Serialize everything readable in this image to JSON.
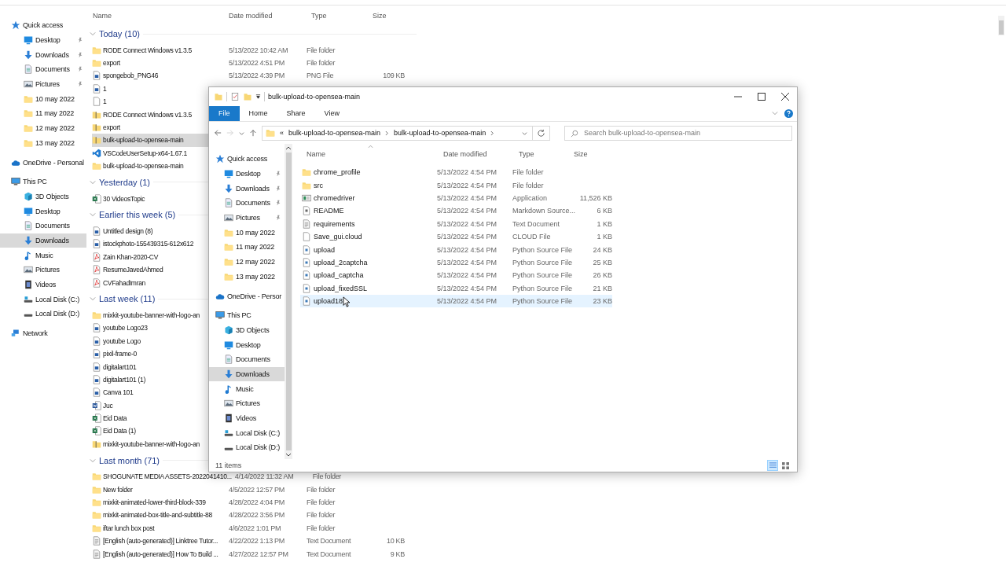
{
  "background_window": {
    "nav": [
      {
        "label": "Quick access",
        "kind": "star",
        "selected": false,
        "children": [
          {
            "label": "Desktop",
            "kind": "desktop",
            "pinned": true,
            "selected": false
          },
          {
            "label": "Downloads",
            "kind": "download",
            "pinned": true,
            "selected": false
          },
          {
            "label": "Documents",
            "kind": "documents",
            "pinned": true,
            "selected": false
          },
          {
            "label": "Pictures",
            "kind": "pictures",
            "pinned": true,
            "selected": false
          },
          {
            "label": "10 may 2022",
            "kind": "folder",
            "pinned": false,
            "selected": false
          },
          {
            "label": "11 may 2022",
            "kind": "folder",
            "pinned": false,
            "selected": false
          },
          {
            "label": "12 may 2022",
            "kind": "folder",
            "pinned": false,
            "selected": false
          },
          {
            "label": "13 may 2022",
            "kind": "folder",
            "pinned": false,
            "selected": false
          }
        ]
      },
      {
        "label": "OneDrive - Personal",
        "kind": "cloud",
        "selected": false
      },
      {
        "label": "This PC",
        "kind": "pc",
        "selected": false,
        "children": [
          {
            "label": "3D Objects",
            "kind": "cube",
            "selected": false
          },
          {
            "label": "Desktop",
            "kind": "desktop",
            "selected": false
          },
          {
            "label": "Documents",
            "kind": "documents",
            "selected": false
          },
          {
            "label": "Downloads",
            "kind": "download",
            "selected": true
          },
          {
            "label": "Music",
            "kind": "music",
            "selected": false
          },
          {
            "label": "Pictures",
            "kind": "pictures",
            "selected": false
          },
          {
            "label": "Videos",
            "kind": "videos",
            "selected": false
          },
          {
            "label": "Local Disk (C:)",
            "kind": "system-disk",
            "selected": false
          },
          {
            "label": "Local Disk (D:)",
            "kind": "disk",
            "selected": false
          }
        ]
      },
      {
        "label": "Network",
        "kind": "network",
        "selected": false
      }
    ],
    "columns": [
      "Name",
      "Date modified",
      "Type",
      "Size"
    ],
    "groups": [
      {
        "title": "Today (10)",
        "expanded": true,
        "rows": [
          {
            "name": "RODE Connect Windows v1.3.5",
            "kind": "folder",
            "date": "5/13/2022 10:42 AM",
            "type": "File folder",
            "selected": false
          },
          {
            "name": "export",
            "kind": "folder",
            "date": "5/13/2022 4:51 PM",
            "type": "File folder",
            "selected": false
          },
          {
            "name": "spongebob_PNG46",
            "kind": "image",
            "date": "5/13/2022 4:39 PM",
            "type": "PNG File",
            "size": "109 KB",
            "selected": false
          },
          {
            "name": "1",
            "kind": "image",
            "selected": false
          },
          {
            "name": "1",
            "kind": "file",
            "selected": false
          },
          {
            "name": "RODE Connect Windows v1.3.5",
            "kind": "zip",
            "selected": false
          },
          {
            "name": "export",
            "kind": "zip",
            "selected": false
          },
          {
            "name": "bulk-upload-to-opensea-main",
            "kind": "zip",
            "selected": true
          },
          {
            "name": "VSCodeUserSetup-x64-1.67.1",
            "kind": "vscode",
            "selected": false
          },
          {
            "name": "bulk-upload-to-opensea-main",
            "kind": "folder",
            "selected": false
          }
        ]
      },
      {
        "title": "Yesterday (1)",
        "expanded": true,
        "rows": [
          {
            "name": "30 VideosTopic",
            "kind": "sheet",
            "selected": false
          }
        ]
      },
      {
        "title": "Earlier this week (5)",
        "expanded": true,
        "rows": [
          {
            "name": "Untitled design (8)",
            "kind": "image",
            "selected": false
          },
          {
            "name": "istockphoto-155439315-612x612",
            "kind": "image",
            "selected": false
          },
          {
            "name": "Zain Khan-2020-CV",
            "kind": "pdf",
            "selected": false
          },
          {
            "name": "ResumeJavedAhmed",
            "kind": "pdf",
            "selected": false
          },
          {
            "name": "CVFahadImran",
            "kind": "pdf",
            "selected": false
          }
        ]
      },
      {
        "title": "Last week (11)",
        "expanded": true,
        "rows": [
          {
            "name": "mixkit-youtube-banner-with-logo-an",
            "kind": "folder",
            "selected": false
          },
          {
            "name": "youtube Logo23",
            "kind": "image",
            "selected": false
          },
          {
            "name": "youtube Logo",
            "kind": "image",
            "selected": false
          },
          {
            "name": "pixil-frame-0",
            "kind": "image",
            "selected": false
          },
          {
            "name": "digitalart101",
            "kind": "image",
            "selected": false
          },
          {
            "name": "digitalart101 (1)",
            "kind": "image",
            "selected": false
          },
          {
            "name": "Canva 101",
            "kind": "image",
            "selected": false
          },
          {
            "name": "Juc",
            "kind": "doc",
            "selected": false
          },
          {
            "name": "Eid Data",
            "kind": "sheet",
            "selected": false
          },
          {
            "name": "Eid Data (1)",
            "kind": "sheet",
            "selected": false
          },
          {
            "name": "mixkit-youtube-banner-with-logo-an",
            "kind": "zip",
            "selected": false
          }
        ]
      },
      {
        "title": "Last month (71)",
        "expanded": true,
        "rows": [
          {
            "name": "SHOGUNATE MEDIA ASSETS-2022041410...",
            "kind": "folder",
            "date": "4/14/2022 11:32 AM",
            "type": "File folder",
            "selected": false
          },
          {
            "name": "New folder",
            "kind": "folder",
            "date": "4/5/2022 12:57 PM",
            "type": "File folder",
            "selected": false
          },
          {
            "name": "mixkit-animated-lower-third-block-339",
            "kind": "folder",
            "date": "4/28/2022 4:04 PM",
            "type": "File folder",
            "selected": false
          },
          {
            "name": "mixkit-animated-box-title-and-subtitle-88",
            "kind": "folder",
            "date": "4/28/2022 3:56 PM",
            "type": "File folder",
            "selected": false
          },
          {
            "name": "iftar lunch box post",
            "kind": "folder",
            "date": "4/6/2022 1:01 PM",
            "type": "File folder",
            "selected": false
          },
          {
            "name": "[English (auto-generated)] Linktree Tutor...",
            "kind": "text",
            "date": "4/22/2022 1:13 PM",
            "type": "Text Document",
            "size": "10 KB",
            "selected": false
          },
          {
            "name": "[English (auto-generated)] How To Build ...",
            "kind": "text",
            "date": "4/27/2022 12:57 PM",
            "type": "Text Document",
            "size": "9 KB",
            "selected": false
          }
        ]
      }
    ]
  },
  "window": {
    "title": "bulk-upload-to-opensea-main",
    "ribbon_tabs": [
      {
        "label": "File",
        "selected": true
      },
      {
        "label": "Home",
        "selected": false
      },
      {
        "label": "Share",
        "selected": false
      },
      {
        "label": "View",
        "selected": false
      }
    ],
    "address": {
      "overflow": "«",
      "path": [
        "bulk-upload-to-opensea-main",
        "bulk-upload-to-opensea-main"
      ]
    },
    "search": {
      "placeholder": "Search bulk-upload-to-opensea-main"
    },
    "nav": [
      {
        "label": "Quick access",
        "kind": "star",
        "selected": false,
        "children": [
          {
            "label": "Desktop",
            "kind": "desktop",
            "pinned": true,
            "selected": false
          },
          {
            "label": "Downloads",
            "kind": "download",
            "pinned": true,
            "selected": false
          },
          {
            "label": "Documents",
            "kind": "documents",
            "pinned": true,
            "selected": false
          },
          {
            "label": "Pictures",
            "kind": "pictures",
            "pinned": true,
            "selected": false
          },
          {
            "label": "10 may 2022",
            "kind": "folder",
            "pinned": false,
            "selected": false
          },
          {
            "label": "11 may 2022",
            "kind": "folder",
            "pinned": false,
            "selected": false
          },
          {
            "label": "12 may 2022",
            "kind": "folder",
            "pinned": false,
            "selected": false
          },
          {
            "label": "13 may 2022",
            "kind": "folder",
            "pinned": false,
            "selected": false
          }
        ]
      },
      {
        "label": "OneDrive - Persor",
        "kind": "cloud",
        "selected": false
      },
      {
        "label": "This PC",
        "kind": "pc",
        "selected": false,
        "children": [
          {
            "label": "3D Objects",
            "kind": "cube",
            "selected": false
          },
          {
            "label": "Desktop",
            "kind": "desktop",
            "selected": false
          },
          {
            "label": "Documents",
            "kind": "documents",
            "selected": false
          },
          {
            "label": "Downloads",
            "kind": "download",
            "selected": true
          },
          {
            "label": "Music",
            "kind": "music",
            "selected": false
          },
          {
            "label": "Pictures",
            "kind": "pictures",
            "selected": false
          },
          {
            "label": "Videos",
            "kind": "videos",
            "selected": false
          },
          {
            "label": "Local Disk (C:)",
            "kind": "system-disk",
            "selected": false
          },
          {
            "label": "Local Disk (D:)",
            "kind": "disk",
            "selected": false
          }
        ]
      }
    ],
    "columns": [
      "Name",
      "Date modified",
      "Type",
      "Size"
    ],
    "rows": [
      {
        "name": "chrome_profile",
        "kind": "folder",
        "date": "5/13/2022 4:54 PM",
        "type": "File folder",
        "selected": false
      },
      {
        "name": "src",
        "kind": "folder",
        "date": "5/13/2022 4:54 PM",
        "type": "File folder",
        "selected": false
      },
      {
        "name": "chromedriver",
        "kind": "app",
        "date": "5/13/2022 4:54 PM",
        "type": "Application",
        "size": "11,526 KB",
        "selected": false
      },
      {
        "name": "README",
        "kind": "markdown",
        "date": "5/13/2022 4:54 PM",
        "type": "Markdown Source...",
        "size": "6 KB",
        "selected": false
      },
      {
        "name": "requirements",
        "kind": "text",
        "date": "5/13/2022 4:54 PM",
        "type": "Text Document",
        "size": "1 KB",
        "selected": false
      },
      {
        "name": "Save_gui.cloud",
        "kind": "file",
        "date": "5/13/2022 4:54 PM",
        "type": "CLOUD File",
        "size": "1 KB",
        "selected": false
      },
      {
        "name": "upload",
        "kind": "python",
        "date": "5/13/2022 4:54 PM",
        "type": "Python Source File",
        "size": "24 KB",
        "selected": false
      },
      {
        "name": "upload_2captcha",
        "kind": "python",
        "date": "5/13/2022 4:54 PM",
        "type": "Python Source File",
        "size": "25 KB",
        "selected": false
      },
      {
        "name": "upload_captcha",
        "kind": "python",
        "date": "5/13/2022 4:54 PM",
        "type": "Python Source File",
        "size": "26 KB",
        "selected": false
      },
      {
        "name": "upload_fixedSSL",
        "kind": "python",
        "date": "5/13/2022 4:54 PM",
        "type": "Python Source File",
        "size": "21 KB",
        "selected": false
      },
      {
        "name": "upload18",
        "kind": "python",
        "date": "5/13/2022 4:54 PM",
        "type": "Python Source File",
        "size": "23 KB",
        "selected": true
      }
    ],
    "status_bar": "11 items",
    "views": [
      {
        "kind": "details",
        "selected": true
      },
      {
        "kind": "tiles",
        "selected": false
      }
    ]
  }
}
